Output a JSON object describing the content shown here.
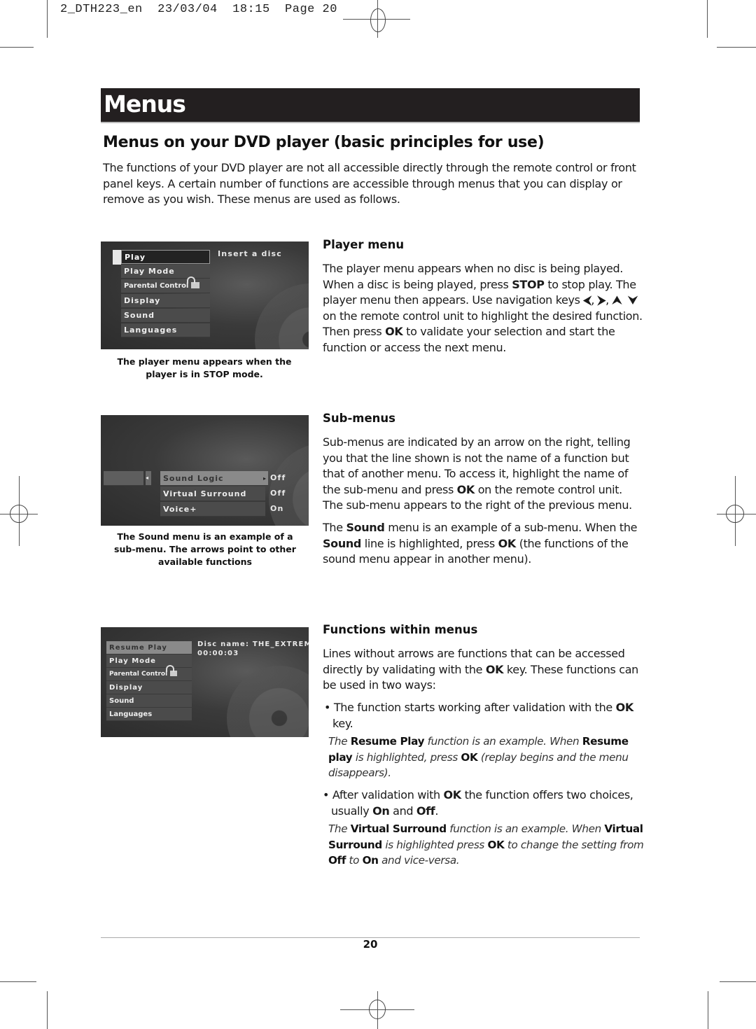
{
  "print_header": "2_DTH223_en  23/03/04  18:15  Page 20",
  "title_bar": "Menus",
  "main_heading": "Menus on your DVD player (basic principles for use)",
  "intro": "The functions of your DVD player are not all accessible directly through the remote control or front panel keys. A certain number of functions are accessible through menus that you can display or remove as you wish. These menus are used as follows.",
  "player_menu": {
    "heading": "Player menu",
    "text_html": "The player menu appears when no disc is being played. When a disc is being played, press <b>STOP</b> to stop play. The player menu then appears. Use navigation keys <b>&#x2B9C;</b>, <b>&#x2B9E;</b>, <b>&#x2B9D;</b> &nbsp;<b>&#x2B9F;</b> on the remote control unit to highlight the desired function. Then press <b>OK</b> to validate your selection and start the function or access the next menu.",
    "screen": {
      "items": [
        "Play",
        "Play Mode",
        "Parental Control",
        "Display",
        "Sound",
        "Languages"
      ],
      "selected": "Play",
      "status": "Insert a disc"
    },
    "caption": "The player menu appears when the player is in STOP mode."
  },
  "sub_menus": {
    "heading": "Sub-menus",
    "text1_html": "Sub-menus are indicated by an arrow on the right, telling you that the line shown is not the name of a function but that of another menu. To access it, highlight the name of the sub-menu and press <b>OK</b> on the remote control unit. The sub-menu appears to the right of the previous menu.",
    "text2_html": "The <b>Sound</b> menu is an example of a sub-menu. When the <b>Sound</b> line is highlighted, press <b>OK</b> (the functions of the sound menu appear in another menu).",
    "screen": {
      "items": [
        {
          "label": "Sound Logic",
          "value": "Off"
        },
        {
          "label": "Virtual Surround",
          "value": "Off"
        },
        {
          "label": "Voice+",
          "value": "On"
        }
      ],
      "highlighted": "Sound Logic"
    },
    "caption": "The Sound menu is an example of a sub-menu. The arrows point to other available functions"
  },
  "functions": {
    "heading": "Functions within menus",
    "text_html": "Lines without arrows are functions that can be accessed directly by validating with the <b>OK</b> key. These functions can be used in two ways:",
    "bullet1_html": "• The function starts working after validation with the <b>OK</b> key.",
    "note1_html": "The <b>Resume Play</b> function is an example. When <b>Resume play</b> is highlighted, press <b>OK</b> (replay begins and the menu disappears).",
    "bullet2_html": "• After validation with <b>OK</b> the function offers two choices, usually <b>On</b> and <b>Off</b>.",
    "note2_html": "The <b>Virtual Surround</b> function is an example. When <b>Virtual Surround</b> is highlighted press <b>OK</b> to change the setting from <b>Off</b> to <b>On</b> and vice-versa.",
    "screen": {
      "items": [
        "Resume Play",
        "Play Mode",
        "Parental Control",
        "Display",
        "Sound",
        "Languages"
      ],
      "highlighted": "Resume Play",
      "disc_name": "Disc name: THE_EXTREME",
      "time": "00:00:03"
    }
  },
  "page_number": "20"
}
